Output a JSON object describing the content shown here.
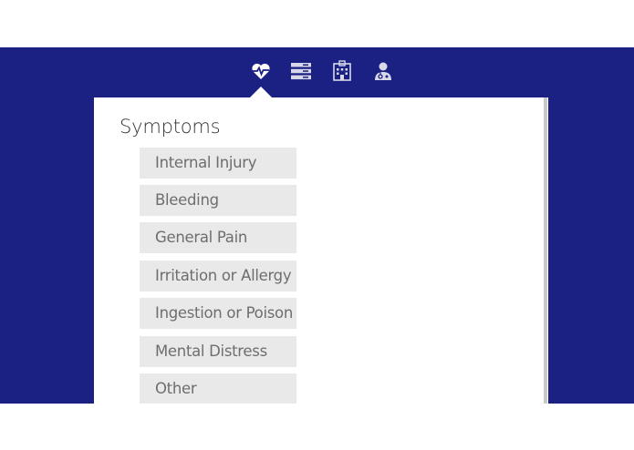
{
  "nav": {
    "icons": [
      {
        "name": "heart-pulse-icon",
        "active": true
      },
      {
        "name": "list-icon",
        "active": false
      },
      {
        "name": "hospital-icon",
        "active": false
      },
      {
        "name": "doctor-icon",
        "active": false
      }
    ]
  },
  "panel": {
    "title": "Symptoms",
    "items": [
      {
        "label": "Internal Injury"
      },
      {
        "label": "Bleeding"
      },
      {
        "label": "General Pain"
      },
      {
        "label": "Irritation or Allergy"
      },
      {
        "label": "Ingestion or Poison"
      },
      {
        "label": "Mental Distress"
      },
      {
        "label": "Other"
      }
    ]
  },
  "colors": {
    "background": "#1b2182",
    "panel": "#ffffff",
    "item_bg": "#e9e9e9",
    "item_text": "#6e6e6e",
    "icon": "#ffffff"
  }
}
